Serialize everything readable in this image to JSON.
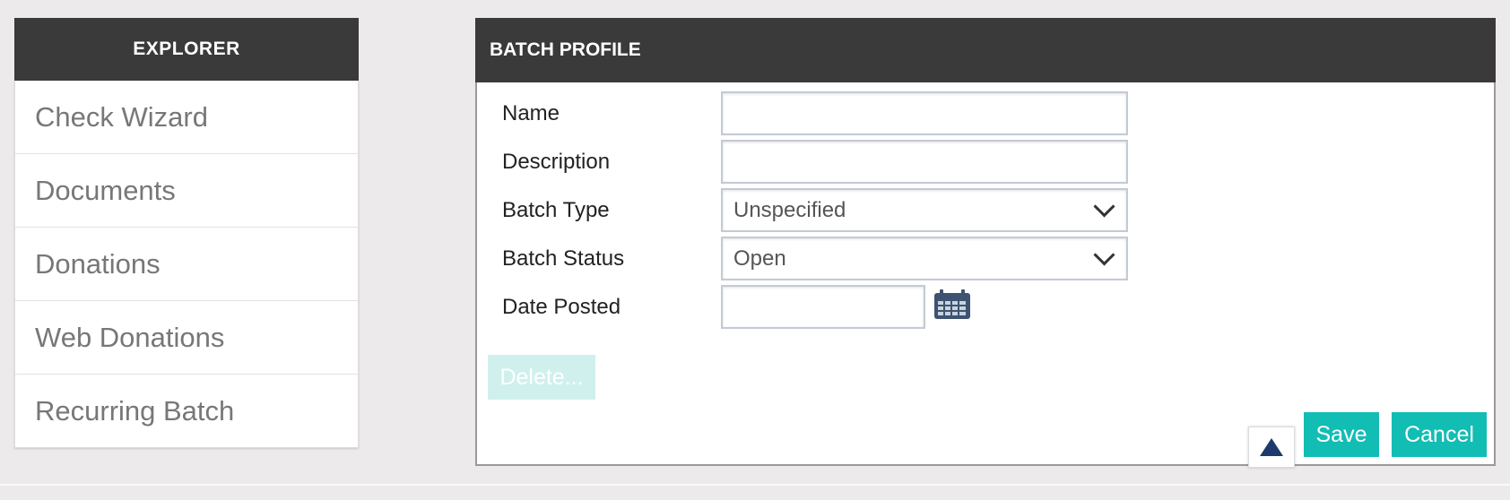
{
  "explorer": {
    "title": "EXPLORER",
    "items": [
      {
        "label": "Check Wizard"
      },
      {
        "label": "Documents"
      },
      {
        "label": "Donations"
      },
      {
        "label": "Web Donations"
      },
      {
        "label": "Recurring Batch"
      }
    ]
  },
  "panel": {
    "title": "BATCH PROFILE",
    "fields": {
      "name_label": "Name",
      "name_value": "",
      "description_label": "Description",
      "description_value": "",
      "batch_type_label": "Batch Type",
      "batch_type_value": "Unspecified",
      "batch_status_label": "Batch Status",
      "batch_status_value": "Open",
      "date_posted_label": "Date Posted",
      "date_posted_value": ""
    },
    "buttons": {
      "delete": "Delete...",
      "save": "Save",
      "cancel": "Cancel"
    }
  },
  "colors": {
    "header_bg": "#3a3a3a",
    "accent": "#12bdb4",
    "accent_disabled": "#d0f0ed",
    "page_bg": "#eceaea"
  },
  "icons": {
    "calendar": "calendar-icon",
    "scroll_top": "triangle-up-icon",
    "dropdown": "chevron-down-icon"
  }
}
